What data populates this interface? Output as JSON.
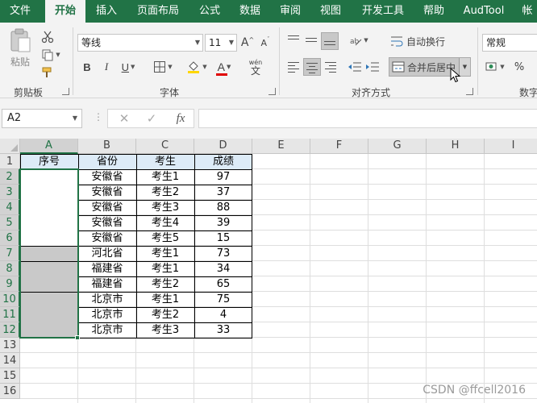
{
  "tabs": [
    "文件",
    "开始",
    "插入",
    "页面布局",
    "公式",
    "数据",
    "审阅",
    "视图",
    "开发工具",
    "帮助",
    "AudTool",
    "帐"
  ],
  "active_tab": "开始",
  "ribbon": {
    "clipboard": {
      "paste_label": "粘贴",
      "group_label": "剪贴板"
    },
    "font": {
      "font_name": "等线",
      "font_size": "11",
      "grow_label": "A",
      "shrink_label": "A",
      "bold": "B",
      "italic": "I",
      "underline": "U",
      "font_color_label": "A",
      "wen_label": "wén",
      "wen_char": "文",
      "group_label": "字体"
    },
    "alignment": {
      "wrap_label": "自动换行",
      "merge_label": "合并后居中",
      "group_label": "对齐方式"
    },
    "number": {
      "format": "常规",
      "percent": "%",
      "group_label": "数字"
    }
  },
  "formula_bar": {
    "name_box": "A2",
    "cancel": "✕",
    "enter": "✓",
    "fx": "fx",
    "formula": ""
  },
  "sheet": {
    "columns": [
      "A",
      "B",
      "C",
      "D",
      "E",
      "F",
      "G",
      "H",
      "I"
    ],
    "rows": [
      "1",
      "2",
      "3",
      "4",
      "5",
      "6",
      "7",
      "8",
      "9",
      "10",
      "11",
      "12",
      "13",
      "14",
      "15",
      "16"
    ],
    "header_row": [
      "序号",
      "省份",
      "考生",
      "成绩"
    ],
    "data": [
      [
        "安徽省",
        "考生1",
        "97"
      ],
      [
        "安徽省",
        "考生2",
        "37"
      ],
      [
        "安徽省",
        "考生3",
        "88"
      ],
      [
        "安徽省",
        "考生4",
        "39"
      ],
      [
        "安徽省",
        "考生5",
        "15"
      ],
      [
        "河北省",
        "考生1",
        "73"
      ],
      [
        "福建省",
        "考生1",
        "34"
      ],
      [
        "福建省",
        "考生2",
        "65"
      ],
      [
        "北京市",
        "考生1",
        "75"
      ],
      [
        "北京市",
        "考生2",
        "4"
      ],
      [
        "北京市",
        "考生3",
        "33"
      ]
    ],
    "selected_cell": "A2",
    "selected_range": "A2:A12"
  },
  "watermark": "CSDN @ffcell2016",
  "colors": {
    "excel_green": "#217346",
    "header_fill": "#ddebf7",
    "merged_grey": "#c9c9c9",
    "ribbon_bg": "#f3f3f3"
  }
}
